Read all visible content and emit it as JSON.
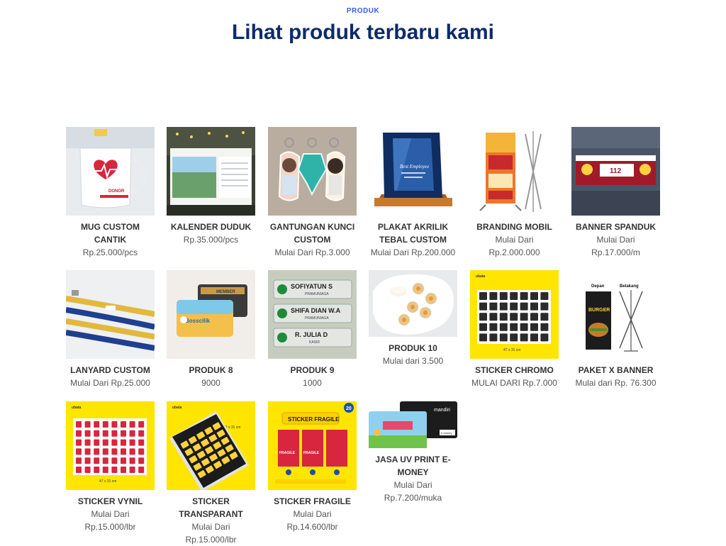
{
  "section": {
    "eyebrow": "PRODUK",
    "title": "Lihat produk terbaru kami"
  },
  "products": [
    {
      "name": "MUG CUSTOM CANTIK",
      "price": "Rp.25.000/pcs",
      "icon": "mug-image"
    },
    {
      "name": "KALENDER DUDUK",
      "price": "Rp.35.000/pcs",
      "icon": "desk-calendar-image"
    },
    {
      "name": "GANTUNGAN KUNCI CUSTOM",
      "price": "Mulai Dari Rp.3.000",
      "icon": "keychain-image"
    },
    {
      "name": "PLAKAT AKRILIK TEBAL CUSTOM",
      "price": "Mulai Dari Rp.200.000",
      "icon": "acrylic-plaque-image"
    },
    {
      "name": "BRANDING MOBIL",
      "price": "Mulai Dari Rp.2.000.000",
      "icon": "x-banner-stand-image"
    },
    {
      "name": "BANNER SPANDUK",
      "price": "Mulai Dari Rp.17.000/m",
      "icon": "banner-image"
    },
    {
      "name": "LANYARD CUSTOM",
      "price": "Mulai Dari Rp.25.000",
      "icon": "lanyard-image"
    },
    {
      "name": "PRODUK 8",
      "price": "9000",
      "icon": "id-card-image"
    },
    {
      "name": "PRODUK 9",
      "price": "1000",
      "icon": "name-tag-image"
    },
    {
      "name": "PRODUK 10",
      "price": "Mulai dari 3.500",
      "icon": "cookies-plate-image"
    },
    {
      "name": "STICKER CHROMO",
      "price": "MULAI DARI Rp.7.000",
      "icon": "sticker-sheet-image"
    },
    {
      "name": "PAKET X BANNER",
      "price": "Mulai dari Rp. 76.300",
      "icon": "x-banner-image"
    },
    {
      "name": "STICKER VYNIL",
      "price": "Mulai Dari Rp.15.000/lbr",
      "icon": "sticker-vinyl-image"
    },
    {
      "name": "STICKER TRANSPARANT",
      "price": "Mulai Dari Rp.15.000/lbr",
      "icon": "sticker-transparent-image"
    },
    {
      "name": "STICKER FRAGILE",
      "price": "Mulai Dari Rp.14.600/lbr",
      "icon": "sticker-fragile-image"
    },
    {
      "name": "JASA UV PRINT E-MONEY",
      "price": "Mulai Dari Rp.7.200/muka",
      "icon": "emoney-card-image"
    }
  ],
  "image_text": {
    "mug": "DONOR",
    "sizes": [
      "47 x 31 cm",
      "47 x 31 cm",
      "47 x 31 cm"
    ],
    "tags": [
      "SOFIYATUN S",
      "PRAMUNIAGA",
      "SHIFA DIAN W.A",
      "PRAMUNIAGA",
      "R. JULIA D",
      "KASIR"
    ],
    "idcard": [
      "Bosscilik",
      "MEMBER"
    ],
    "plaque": "Best Employee",
    "banner": "112",
    "xbanner": [
      "Depan",
      "Belakang",
      "BURGER"
    ],
    "fragile": [
      "STICKER FRAGILE",
      "20",
      "FRAGILE",
      "FRAGILE"
    ],
    "emoney": [
      "mandiri",
      "e-money"
    ],
    "logo": "ubata"
  },
  "colors": {
    "eyebrow": "#3b5bdb",
    "title": "#0d2b6b",
    "sticker_yellow": "#ffe500"
  }
}
